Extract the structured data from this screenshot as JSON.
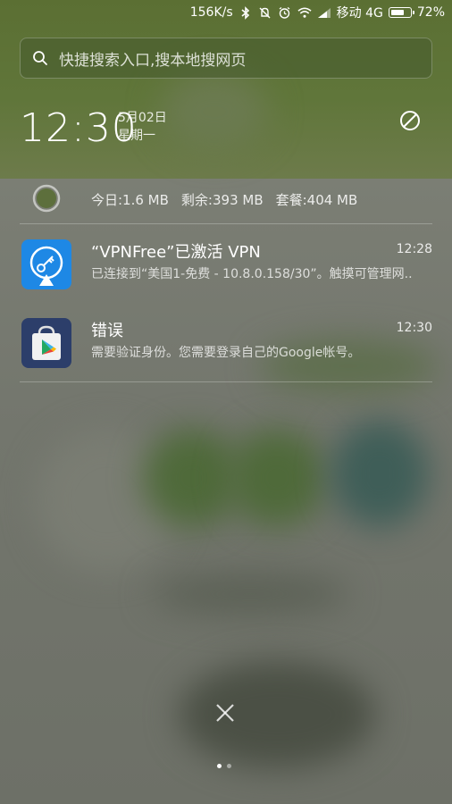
{
  "status_bar": {
    "net_speed": "156K/s",
    "carrier": "移动 4G",
    "battery_percent": "72%",
    "battery_level": 0.72
  },
  "search": {
    "placeholder": "快捷搜索入口,搜本地搜网页"
  },
  "lock": {
    "time": "12:30",
    "date": "5月02日",
    "weekday": "星期一"
  },
  "data_usage": {
    "today": "今日:1.6 MB",
    "remaining": "剩余:393 MB",
    "plan": "套餐:404 MB"
  },
  "notifications": [
    {
      "title": "“VPNFree”已激活 VPN",
      "time": "12:28",
      "body": "已连接到“美国1-免费 - 10.8.0.158/30”。触摸可管理网..",
      "icon": "vpn-key-icon",
      "icon_color": "#1e88e5"
    },
    {
      "title": "错误",
      "time": "12:30",
      "body": "需要验证身份。您需要登录自己的Google帐号。",
      "icon": "google-play-store-icon",
      "icon_color": "#2c3e6a"
    }
  ],
  "pager": {
    "active_index": 0,
    "count": 2
  }
}
